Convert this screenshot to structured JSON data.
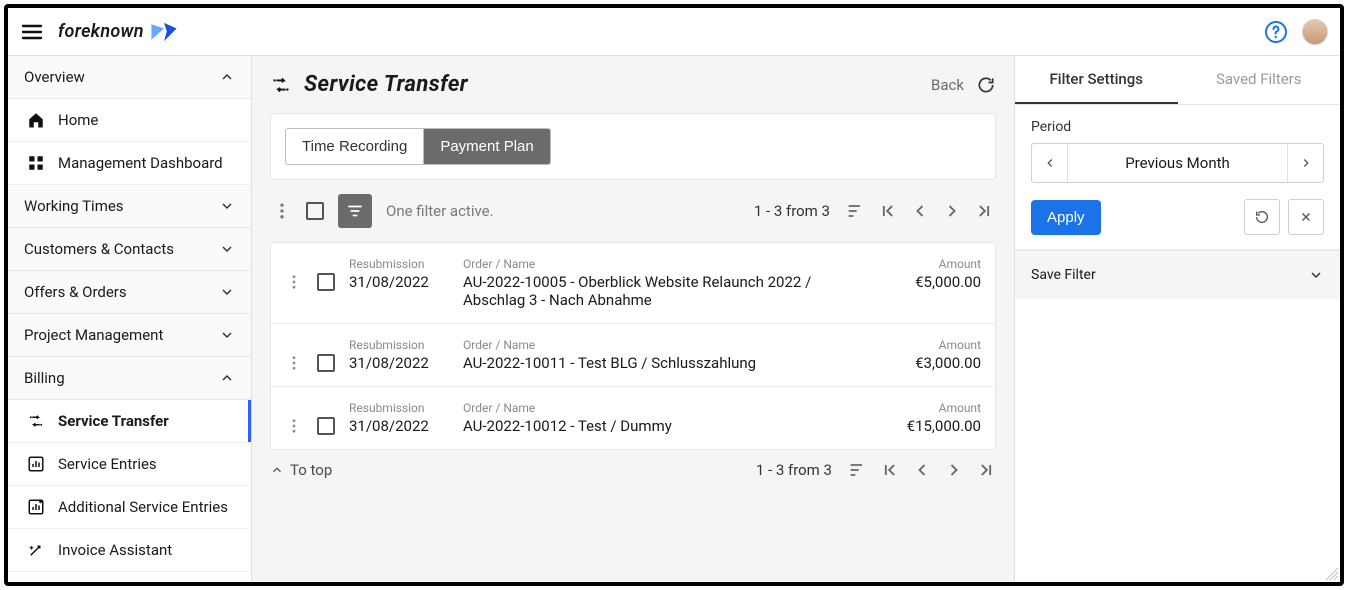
{
  "brand": {
    "name": "foreknown"
  },
  "sidebar": {
    "overview": {
      "label": "Overview"
    },
    "home": {
      "label": "Home"
    },
    "mgmtDashboard": {
      "label": "Management Dashboard"
    },
    "workingTimes": {
      "label": "Working Times"
    },
    "customersContacts": {
      "label": "Customers & Contacts"
    },
    "offersOrders": {
      "label": "Offers & Orders"
    },
    "projectMgmt": {
      "label": "Project Management"
    },
    "billing": {
      "label": "Billing"
    },
    "serviceTransfer": {
      "label": "Service Transfer"
    },
    "serviceEntries": {
      "label": "Service Entries"
    },
    "additionalServiceEntries": {
      "label": "Additional Service Entries"
    },
    "invoiceAssistant": {
      "label": "Invoice Assistant"
    }
  },
  "page": {
    "title": "Service Transfer",
    "back": "Back"
  },
  "tabs": {
    "timeRecording": "Time Recording",
    "paymentPlan": "Payment Plan"
  },
  "toolbar": {
    "filterActive": "One filter active.",
    "range": "1 - 3 from 3"
  },
  "columns": {
    "resubmission": "Resubmission",
    "orderName": "Order / Name",
    "amount": "Amount"
  },
  "rows": [
    {
      "date": "31/08/2022",
      "name": "AU-2022-10005 - Oberblick Website Relaunch 2022 / Abschlag 3 - Nach Abnahme",
      "amount": "€5,000.00"
    },
    {
      "date": "31/08/2022",
      "name": "AU-2022-10011 - Test BLG / Schlusszahlung",
      "amount": "€3,000.00"
    },
    {
      "date": "31/08/2022",
      "name": "AU-2022-10012 - Test / Dummy",
      "amount": "€15,000.00"
    }
  ],
  "footer": {
    "toTop": "To top",
    "range": "1 - 3 from 3"
  },
  "filter": {
    "tabSettings": "Filter Settings",
    "tabSaved": "Saved Filters",
    "periodLabel": "Period",
    "periodValue": "Previous Month",
    "apply": "Apply",
    "saveFilter": "Save Filter"
  }
}
